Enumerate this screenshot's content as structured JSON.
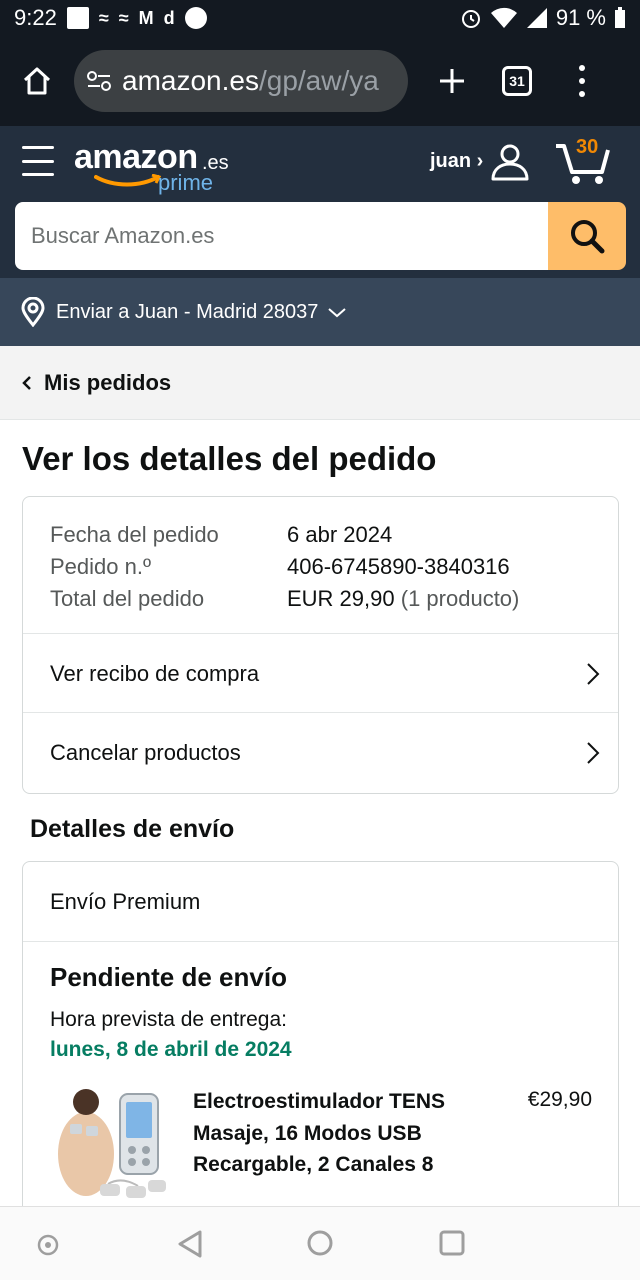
{
  "status_bar": {
    "time": "9:22",
    "battery": "91 %"
  },
  "browser": {
    "url_host": "amazon.es",
    "url_path": "/gp/aw/ya",
    "tab_count": "31"
  },
  "header": {
    "logo": "amazon",
    "logo_suffix": ".es",
    "logo_prime": "prime",
    "user": "juan ›",
    "cart_count": "30",
    "search_placeholder": "Buscar Amazon.es"
  },
  "deliver_to": "Enviar a Juan - Madrid 28037",
  "breadcrumb": "Mis pedidos",
  "page_title": "Ver los detalles del pedido",
  "order_summary": {
    "rows": [
      {
        "label": "Fecha del pedido",
        "value": "6 abr 2024"
      },
      {
        "label": "Pedido n.º",
        "value": "406-6745890-3840316"
      },
      {
        "label": "Total del pedido",
        "value": "EUR 29,90",
        "extra": "(1 producto)"
      }
    ],
    "links": [
      "Ver recibo de compra",
      "Cancelar productos"
    ]
  },
  "shipping": {
    "section_title": "Detalles de envío",
    "method": "Envío Premium",
    "status": "Pendiente de envío",
    "eta_label": "Hora prevista de entrega:",
    "eta_date": "lunes, 8 de abril de 2024",
    "product": {
      "title": "Electroestimulador TENS Masaje, 16 Modos USB Recargable, 2 Canales 8",
      "price": "€29,90"
    }
  },
  "colors": {
    "header_dark": "#131921",
    "header_nav": "#232f3e",
    "deliver_bar": "#37475a",
    "search_button": "#febd69",
    "delivery_green": "#067d62",
    "cart_orange": "#f08804"
  },
  "icons": [
    "home-icon",
    "site-settings-icon",
    "plus-icon",
    "tabs-icon",
    "overflow-menu-icon",
    "hamburger-icon",
    "user-icon",
    "cart-icon",
    "search-icon",
    "location-pin-icon",
    "chevron-down-icon",
    "chevron-left-icon",
    "chevron-right-icon"
  ]
}
